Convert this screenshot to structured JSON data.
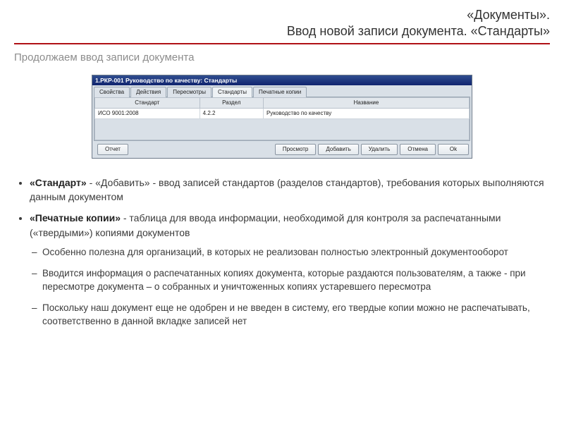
{
  "page": {
    "heading_line1": "«Документы».",
    "heading_line2": "Ввод новой записи документа. «Стандарты»",
    "subheading": "Продолжаем ввод записи документа"
  },
  "app": {
    "title": "1.РКР-001 Руководство по качеству: Стандарты",
    "tabs": [
      {
        "label": "Свойства"
      },
      {
        "label": "Действия"
      },
      {
        "label": "Пересмотры"
      },
      {
        "label": "Стандарты",
        "active": true
      },
      {
        "label": "Печатные копии"
      }
    ],
    "columns": {
      "c1": "Стандарт",
      "c2": "Раздел",
      "c3": "Название"
    },
    "rows": [
      {
        "standard": "ИСО 9001:2008",
        "section": "4.2.2",
        "name": "Руководство по качеству"
      }
    ],
    "buttons": {
      "report": "Отчет",
      "view": "Просмотр",
      "add": "Добавить",
      "remove": "Удалить",
      "cancel": "Отмена",
      "ok": "Ok"
    }
  },
  "body": {
    "b1_strong": "«Стандарт»",
    "b1_rest": " - «Добавить» - ввод записей стандартов (разделов стандартов), требования которых выполняются данным документом",
    "b2_strong": "«Печатные копии»",
    "b2_rest": " - таблица для ввода информации, необходимой для контроля за распечатанными («твердыми») копиями документов",
    "sub1": "Особенно полезна для организаций, в которых не реализован полностью электронный документооборот",
    "sub2": "Вводится информация о распечатанных копиях документа, которые раздаются пользователям, а также  - при пересмотре документа – о собранных и уничтоженных копиях устаревшего пересмотра",
    "sub3": "Поскольку наш документ еще не одобрен и не введен в систему, его твердые копии можно не распечатывать, соответственно в данной вкладке записей нет"
  }
}
